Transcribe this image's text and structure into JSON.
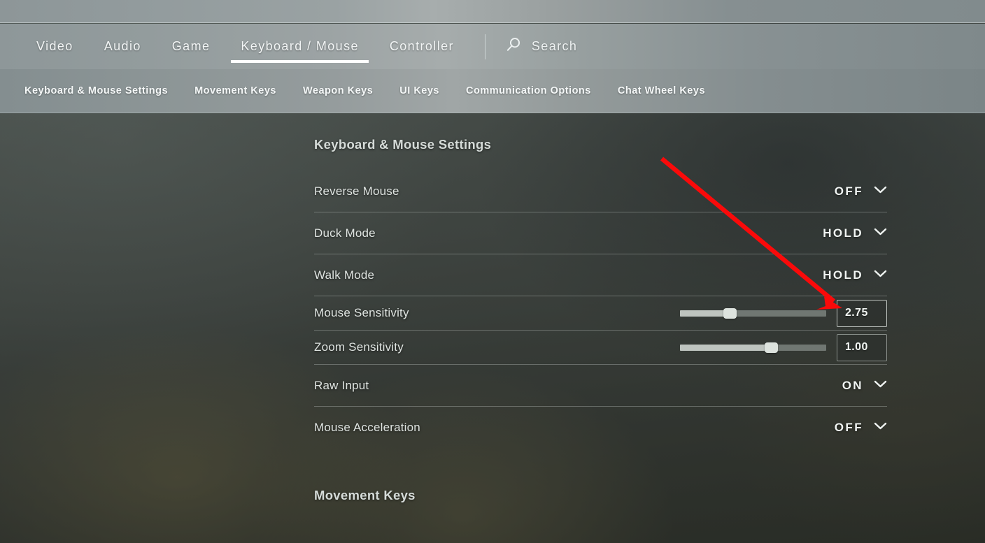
{
  "primary_nav": {
    "tabs": [
      {
        "label": "Video",
        "active": false
      },
      {
        "label": "Audio",
        "active": false
      },
      {
        "label": "Game",
        "active": false
      },
      {
        "label": "Keyboard / Mouse",
        "active": true
      },
      {
        "label": "Controller",
        "active": false
      }
    ],
    "search_label": "Search",
    "search_icon": "search-icon"
  },
  "secondary_nav": {
    "tabs": [
      {
        "label": "Keyboard & Mouse Settings"
      },
      {
        "label": "Movement Keys"
      },
      {
        "label": "Weapon Keys"
      },
      {
        "label": "UI Keys"
      },
      {
        "label": "Communication Options"
      },
      {
        "label": "Chat Wheel Keys"
      }
    ]
  },
  "settings": {
    "section_title": "Keyboard & Mouse Settings",
    "rows": [
      {
        "label": "Reverse Mouse",
        "type": "dropdown",
        "value": "OFF"
      },
      {
        "label": "Duck Mode",
        "type": "dropdown",
        "value": "HOLD"
      },
      {
        "label": "Walk Mode",
        "type": "dropdown",
        "value": "HOLD"
      },
      {
        "label": "Mouse Sensitivity",
        "type": "slider",
        "value": "2.75",
        "percent": 34,
        "highlighted": true
      },
      {
        "label": "Zoom Sensitivity",
        "type": "slider",
        "value": "1.00",
        "percent": 62,
        "highlighted": false
      },
      {
        "label": "Raw Input",
        "type": "dropdown",
        "value": "ON"
      },
      {
        "label": "Mouse Acceleration",
        "type": "dropdown",
        "value": "OFF"
      }
    ]
  },
  "movement_section": {
    "title": "Movement Keys"
  },
  "annotation": {
    "type": "arrow",
    "color": "#fa0a0a",
    "points": "from (946,227) to (1203,440)",
    "target": "mouse-sensitivity-value-box"
  }
}
